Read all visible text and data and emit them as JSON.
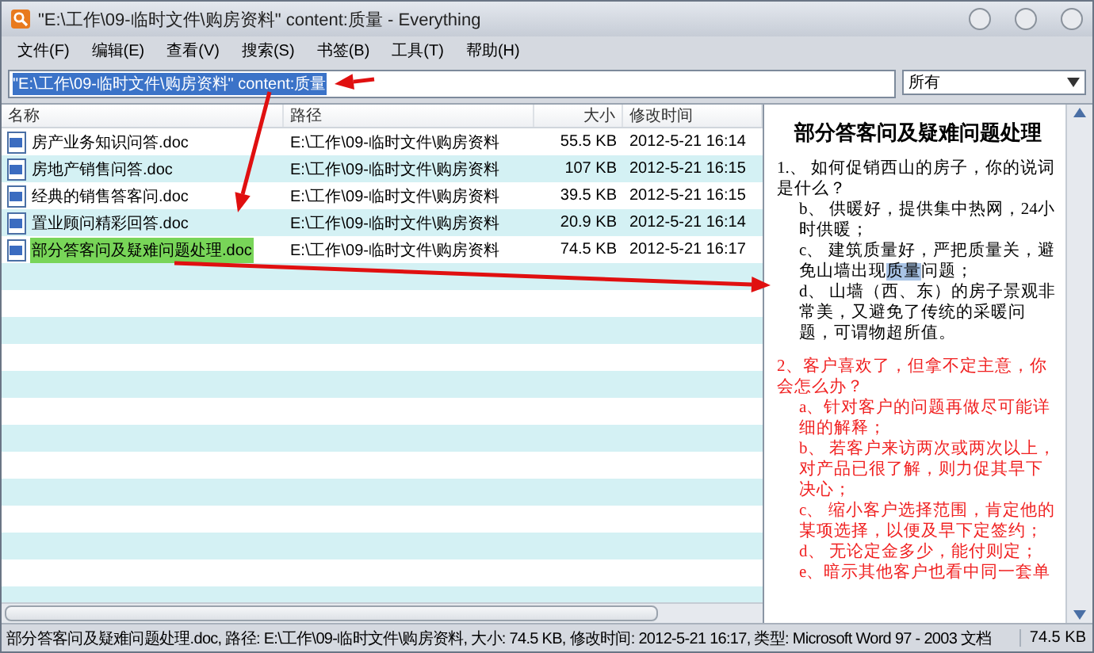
{
  "window": {
    "title": "\"E:\\工作\\09-临时文件\\购房资料\" content:质量 - Everything"
  },
  "menu": [
    "文件(F)",
    "编辑(E)",
    "查看(V)",
    "搜索(S)",
    "书签(B)",
    "工具(T)",
    "帮助(H)"
  ],
  "search": {
    "value": "\"E:\\工作\\09-临时文件\\购房资料\" content:质量",
    "filter": "所有"
  },
  "table": {
    "columns": [
      "名称",
      "路径",
      "大小",
      "修改时间"
    ],
    "rows": [
      {
        "name": "房产业务知识问答.doc",
        "path": "E:\\工作\\09-临时文件\\购房资料",
        "size": "55.5 KB",
        "modified": "2012-5-21 16:14",
        "selected": false
      },
      {
        "name": "房地产销售问答.doc",
        "path": "E:\\工作\\09-临时文件\\购房资料",
        "size": "107 KB",
        "modified": "2012-5-21 16:15",
        "selected": false
      },
      {
        "name": "经典的销售答客问.doc",
        "path": "E:\\工作\\09-临时文件\\购房资料",
        "size": "39.5 KB",
        "modified": "2012-5-21 16:15",
        "selected": false
      },
      {
        "name": "置业顾问精彩回答.doc",
        "path": "E:\\工作\\09-临时文件\\购房资料",
        "size": "20.9 KB",
        "modified": "2012-5-21 16:14",
        "selected": false
      },
      {
        "name": "部分答客问及疑难问题处理.doc",
        "path": "E:\\工作\\09-临时文件\\购房资料",
        "size": "74.5 KB",
        "modified": "2012-5-21 16:17",
        "selected": true
      }
    ]
  },
  "preview": {
    "title": "部分答客问及疑难问题处理",
    "paragraphs": [
      {
        "kind": "plain",
        "question": "1.、 如何促销西山的房子，你的说词是什么？",
        "items": [
          [
            {
              "text": "b、 供暖好，提供集中热网，24小时供暖；",
              "highlighted": false
            }
          ],
          [
            {
              "text": "c、 建筑质量好，严把质量关，避免山墙出现",
              "highlighted": false
            },
            {
              "text": "质量",
              "highlighted": true
            },
            {
              "text": "问题；",
              "highlighted": false
            }
          ],
          [
            {
              "text": "d、 山墙（西、东）的房子景观非常美，又避免了传统的采暖问题，可谓物超所值。",
              "highlighted": false
            }
          ]
        ]
      },
      {
        "kind": "red",
        "question": "2、客户喜欢了，但拿不定主意，你会怎么办？",
        "items": [
          [
            {
              "text": "a、针对客户的问题再做尽可能详细的解释；",
              "highlighted": false
            }
          ],
          [
            {
              "text": "b、 若客户来访两次或两次以上，对产品已很了解，则力促其早下决心；",
              "highlighted": false
            }
          ],
          [
            {
              "text": "c、 缩小客户选择范围，肯定他的某项选择，以便及早下定签约；",
              "highlighted": false
            }
          ],
          [
            {
              "text": "d、 无论定金多少，能付则定；",
              "highlighted": false
            }
          ],
          [
            {
              "text": "e、暗示其他客户也看中同一套单",
              "highlighted": false
            }
          ]
        ]
      }
    ]
  },
  "status_bar": {
    "text": "部分答客问及疑难问题处理.doc, 路径: E:\\工作\\09-临时文件\\购房资料, 大小: 74.5 KB, 修改时间: 2012-5-21 16:17, 类型: Microsoft Word 97 - 2003 文档",
    "size": "74.5 KB"
  }
}
